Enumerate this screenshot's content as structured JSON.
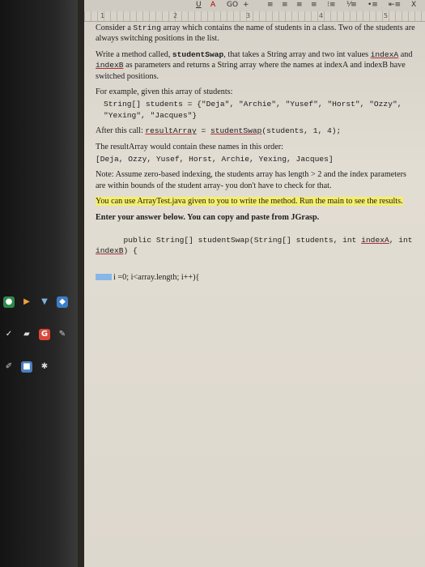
{
  "toolbar": {
    "underline": "U",
    "font_color": "A",
    "link": "GO",
    "plus": "+",
    "close": "X"
  },
  "ruler": [
    "1",
    "2",
    "3",
    "4",
    "5"
  ],
  "doc": {
    "p1_lead": "Consider a",
    "p1_code": "String",
    "p1_rest": "array which contains the name of students in a class. Two of the students are always switching positions in the list.",
    "p2_a": "Write a method called,",
    "p2_method": "studentSwap",
    "p2_b": ", that takes a String array and two int values",
    "p2_indexA": "indexA",
    "p2_c": "and",
    "p2_indexB": "indexB",
    "p2_d": "as parameters and returns a String array where the names at indexA and indexB have switched positions.",
    "p3": "For example, given this array of students:",
    "code1": "String[] students = {\"Deja\", \"Archie\", \"Yusef\", \"Horst\", \"Ozzy\", \"Yexing\", \"Jacques\"}",
    "p4_a": "After this call:",
    "p4_result": "resultArray",
    "p4_eq": " = ",
    "p4_call": "studentSwap",
    "p4_args": "(students, 1, 4);",
    "p5": "The resultArray would contain these names in this order:",
    "code2": "[Deja, Ozzy, Yusef, Horst, Archie, Yexing, Jacques]",
    "p6": "Note: Assume zero-based indexing, the students array has length > 2 and the index parameters are within bounds of the student array- you don't have to check for that.",
    "p7": "You can use ArrayTest.java given to you to write the method. Run the main to see the results.",
    "p8": "Enter your answer below. You can copy and paste from JGrasp.",
    "code3_a": "public String[] studentSwap(String[] students, int ",
    "code3_indexA": "indexA",
    "code3_b": ", int ",
    "code3_indexB": "indexB",
    "code3_c": ") {",
    "p9": "i =0; i<array.length; i++){"
  },
  "colors": {
    "highlight": "#f5ee6a",
    "underline": "#b0303a",
    "taskbar": "#1a1a1a"
  }
}
